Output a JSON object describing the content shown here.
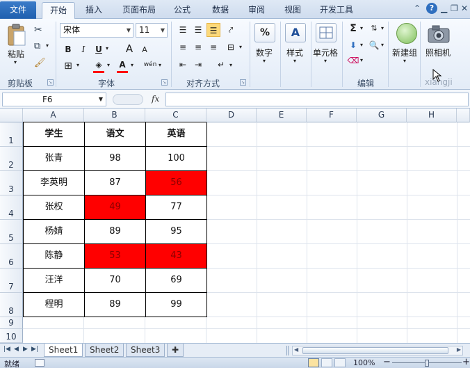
{
  "tabs": {
    "file": "文件",
    "items": [
      "开始",
      "插入",
      "页面布局",
      "公式",
      "数据",
      "审阅",
      "视图",
      "开发工具"
    ]
  },
  "ribbon": {
    "clipboard": {
      "paste": "粘贴",
      "label": "剪贴板"
    },
    "font": {
      "name": "宋体",
      "size": "11",
      "label": "字体",
      "bold": "B",
      "italic": "I",
      "underline": "U",
      "grow": "A",
      "shrink": "A",
      "phonetic": "wén"
    },
    "alignment": {
      "label": "对齐方式"
    },
    "number": {
      "label": "数字",
      "icon_text": "%"
    },
    "styles": {
      "label": "样式"
    },
    "cells": {
      "label": "单元格"
    },
    "editing": {
      "label": "编辑"
    },
    "newgroup": {
      "button": "新建组"
    },
    "camera": {
      "button": "照相机",
      "group_label": "xiangji"
    }
  },
  "formula": {
    "namebox": "F6",
    "fx": "fx",
    "value": ""
  },
  "grid": {
    "columns": [
      "A",
      "B",
      "C",
      "D",
      "E",
      "F",
      "G",
      "H"
    ],
    "rows": [
      "1",
      "2",
      "3",
      "4",
      "5",
      "6",
      "7",
      "8",
      "9",
      "10"
    ],
    "table": {
      "header": [
        "学生",
        "语文",
        "英语"
      ],
      "rows": [
        [
          "张青",
          "98",
          "100"
        ],
        [
          "李英明",
          "87",
          "56"
        ],
        [
          "张权",
          "49",
          "77"
        ],
        [
          "杨婧",
          "89",
          "95"
        ],
        [
          "陈静",
          "53",
          "43"
        ],
        [
          "汪洋",
          "70",
          "69"
        ],
        [
          "程明",
          "89",
          "99"
        ]
      ]
    },
    "highlight_color": "#ff0000"
  },
  "sheets": [
    "Sheet1",
    "Sheet2",
    "Sheet3"
  ],
  "status": {
    "ready": "就绪",
    "zoom": "100%",
    "minus": "−",
    "plus": "+"
  },
  "icons": {
    "paste": "clipboard-icon",
    "cut": "scissors-icon",
    "copy": "copy-icon",
    "format_painter": "brush-icon",
    "help": "help-icon",
    "minimize": "minimize-icon",
    "restore": "restore-icon",
    "close": "close-icon"
  }
}
